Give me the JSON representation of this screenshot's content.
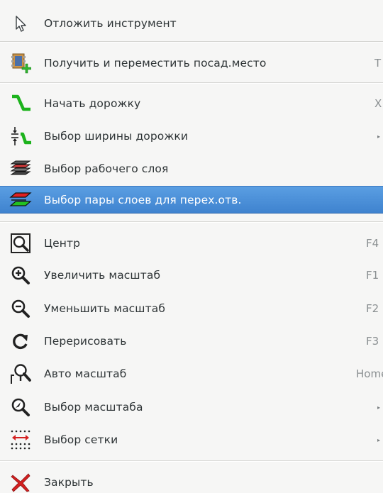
{
  "menu": {
    "items": [
      {
        "label": "Отложить инструмент",
        "shortcut": "",
        "icon": "cursor-arrow-icon"
      },
      {
        "label": "Получить и переместить посад.место",
        "shortcut": "T",
        "icon": "footprint-move-icon"
      },
      {
        "label": "Начать дорожку",
        "shortcut": "X",
        "icon": "track-icon"
      },
      {
        "label": "Выбор ширины дорожки",
        "shortcut": "",
        "icon": "track-width-icon",
        "submenu": true
      },
      {
        "label": "Выбор рабочего слоя",
        "shortcut": "",
        "icon": "layer-select-icon"
      },
      {
        "label": "Выбор пары слоев для перех.отв.",
        "shortcut": "",
        "icon": "layer-pair-icon",
        "active": true
      },
      {
        "label": "Центр",
        "shortcut": "F4",
        "icon": "zoom-center-icon"
      },
      {
        "label": "Увеличить масштаб",
        "shortcut": "F1",
        "icon": "zoom-in-icon"
      },
      {
        "label": "Уменьшить масштаб",
        "shortcut": "F2",
        "icon": "zoom-out-icon"
      },
      {
        "label": "Перерисовать",
        "shortcut": "F3",
        "icon": "redraw-icon"
      },
      {
        "label": "Авто масштаб",
        "shortcut": "Home",
        "icon": "zoom-auto-icon"
      },
      {
        "label": "Выбор масштаба",
        "shortcut": "",
        "icon": "zoom-select-icon",
        "submenu": true
      },
      {
        "label": "Выбор сетки",
        "shortcut": "",
        "icon": "grid-select-icon",
        "submenu": true
      },
      {
        "label": "Закрыть",
        "shortcut": "",
        "icon": "close-icon"
      }
    ]
  },
  "colors": {
    "highlight": "#4a90d9",
    "text": "#2e3436",
    "shortcut": "#8a8f91",
    "track_green": "#1db31d",
    "close_red": "#d42020"
  }
}
